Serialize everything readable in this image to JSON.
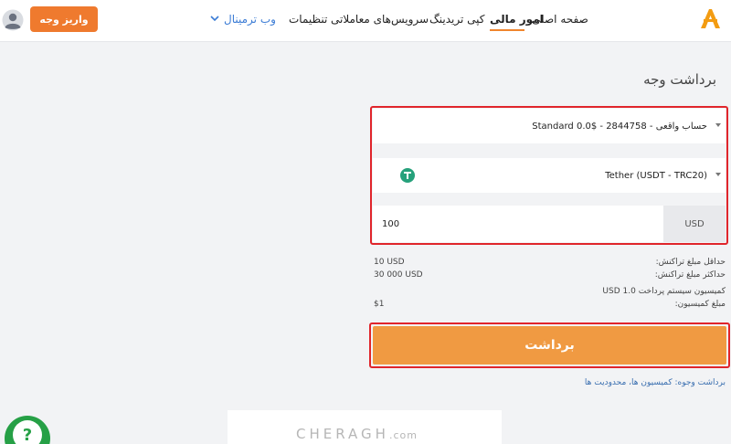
{
  "header": {
    "nav": {
      "home": "صفحه اصلی",
      "finance": "امور مالی",
      "copy_trading": "کپی تریدینگ",
      "trading_services": "سرویس‌های معاملاتی",
      "settings": "تنظیمات",
      "web_terminal": "وب ترمینال"
    },
    "deposit_button": "واریز وجه",
    "icons": {
      "logo": "alpari-logo",
      "chevron": "chevron-down-icon",
      "avatar": "user-avatar-icon"
    },
    "accent_color": "#ef7a2e"
  },
  "page": {
    "title": "برداشت وجه",
    "account_select": "حساب واقعی - 2844758 - Standard 0.0$",
    "currency_select": "Tether (USDT - TRC20)",
    "currency_icon": "tether-icon",
    "amount_value": "100",
    "amount_currency": "USD",
    "info": {
      "min_label": "حداقل مبلغ تراکنش:",
      "min_value": "10 USD",
      "max_label": "حداکثر مبلغ تراکنش:",
      "max_value": "30 000 USD",
      "fee_system_label": "کمیسیون سیستم پرداخت 1.0 USD",
      "fee_amount_label": "مبلغ کمیسیون:",
      "fee_amount_value": "$1"
    },
    "withdraw_button": "برداشت",
    "footer_link": "برداشت وجوه: کمیسیون ها، محدودیت ها",
    "highlight_color": "#e0252b",
    "button_color": "#f09a42"
  },
  "watermark": {
    "brand": "CHERAGH",
    "suffix": ".com"
  },
  "help_button": {
    "label": "?",
    "color": "#26a046"
  }
}
